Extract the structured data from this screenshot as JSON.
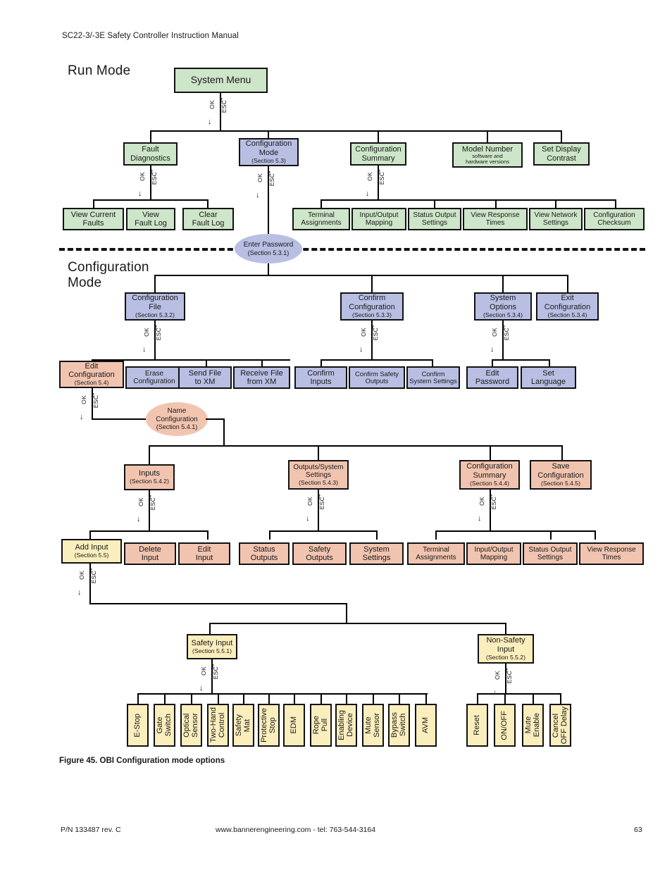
{
  "header": {
    "title": "SC22-3/-3E Safety Controller Instruction Manual"
  },
  "sections": {
    "run_mode": "Run Mode",
    "configuration_mode": "Configuration\nMode"
  },
  "caption": "Figure 45. OBI Configuration mode options",
  "footer": {
    "left": "P/N 133487 rev. C",
    "center": "www.bannerengineering.com - tel: 763-544-3164",
    "right": "63"
  },
  "keys": {
    "ok": "OK",
    "esc": "ESC",
    "arrow_down": "↓",
    "arrow_up": "↑"
  },
  "colors": {
    "green": "#cde5c8",
    "blue": "#b9bfe3",
    "salmon": "#f1c4b0",
    "yellow": "#faeebd",
    "border": "#111111"
  },
  "run_mode_nodes": {
    "system_menu": {
      "label": "System Menu"
    },
    "fault_diagnostics": {
      "label": "Fault\nDiagnostics"
    },
    "configuration_mode": {
      "label": "Configuration\nMode",
      "section": "(Section 5.3)"
    },
    "configuration_summary": {
      "label": "Configuration\nSummary"
    },
    "model_number": {
      "label": "Model Number",
      "sub": "software and\nhardware versions"
    },
    "set_display_contrast": {
      "label": "Set Display\nContrast"
    },
    "fault_children": [
      {
        "label": "View Current\nFaults"
      },
      {
        "label": "View\nFault Log"
      },
      {
        "label": "Clear\nFault Log"
      }
    ],
    "summary_children": [
      {
        "label": "Terminal\nAssignments"
      },
      {
        "label": "Input/Output\nMapping"
      },
      {
        "label": "Status Output\nSettings"
      },
      {
        "label": "View Response\nTimes"
      },
      {
        "label": "View Network\nSettings"
      },
      {
        "label": "Configuration\nChecksum"
      }
    ]
  },
  "enter_password": {
    "label": "Enter Password",
    "section": "(Section 5.3.1)"
  },
  "config_mode_nodes": {
    "configuration_file": {
      "label": "Configuration\nFile",
      "section": "(Section 5.3.2)"
    },
    "confirm_configuration": {
      "label": "Confirm\nConfiguration",
      "section": "(Section 5.3.3)"
    },
    "system_options": {
      "label": "System\nOptions",
      "section": "(Section 5.3.4)"
    },
    "exit_configuration": {
      "label": "Exit\nConfiguration",
      "section": "(Section 5.3.4)"
    },
    "file_children": [
      {
        "label": "Edit\nConfiguration",
        "section": "(Section 5.4)",
        "color": "salmon"
      },
      {
        "label": "Erase\nConfiguration",
        "color": "blue"
      },
      {
        "label": "Send File\nto XM",
        "color": "blue"
      },
      {
        "label": "Receive File\nfrom XM",
        "color": "blue"
      }
    ],
    "confirm_children": [
      {
        "label": "Confirm\nInputs"
      },
      {
        "label": "Confirm Safety\nOutputs"
      },
      {
        "label": "Confirm\nSystem Settings"
      }
    ],
    "options_children": [
      {
        "label": "Edit\nPassword"
      },
      {
        "label": "Set\nLanguage"
      }
    ]
  },
  "name_configuration": {
    "label": "Name\nConfiguration",
    "section": "(Section 5.4.1)"
  },
  "edit_config_nodes": {
    "inputs": {
      "label": "Inputs",
      "section": "(Section 5.4.2)"
    },
    "outputs_system_settings": {
      "label": "Outputs/System\nSettings",
      "section": "(Section 5.4.3)"
    },
    "configuration_summary": {
      "label": "Configuration\nSummary",
      "section": "(Section 5.4.4)"
    },
    "save_configuration": {
      "label": "Save\nConfiguration",
      "section": "(Section 5.4.5)"
    },
    "inputs_children": [
      {
        "label": "Add Input",
        "section": "(Section 5.5)",
        "color": "yellow"
      },
      {
        "label": "Delete\nInput",
        "color": "salmon"
      },
      {
        "label": "Edit\nInput",
        "color": "salmon"
      }
    ],
    "outputs_children": [
      {
        "label": "Status\nOutputs"
      },
      {
        "label": "Safety\nOutputs"
      },
      {
        "label": "System\nSettings"
      }
    ],
    "summary_children": [
      {
        "label": "Terminal\nAssignments"
      },
      {
        "label": "Input/Output\nMapping"
      },
      {
        "label": "Status Output\nSettings"
      },
      {
        "label": "View Response\nTimes"
      }
    ]
  },
  "add_input_nodes": {
    "safety_input": {
      "label": "Safety Input",
      "section": "(Section 5.5.1)"
    },
    "non_safety_input": {
      "label": "Non-Safety\nInput",
      "section": "(Section 5.5.2)"
    },
    "safety_types": [
      {
        "label": "E-Stop"
      },
      {
        "label": "Gate\nSwitch"
      },
      {
        "label": "Optical\nSensor"
      },
      {
        "label": "Two-Hand\nControl"
      },
      {
        "label": "Safety\nMat"
      },
      {
        "label": "Protective\nStop"
      },
      {
        "label": "EDM"
      },
      {
        "label": "Rope\nPull"
      },
      {
        "label": "Enabling\nDevice"
      },
      {
        "label": "Mute\nSensor"
      },
      {
        "label": "Bypass\nSwitch"
      },
      {
        "label": "AVM"
      }
    ],
    "non_safety_types": [
      {
        "label": "Reset"
      },
      {
        "label": "ON/OFF"
      },
      {
        "label": "Mute\nEnable"
      },
      {
        "label": "Cancel\nOFF Delay"
      }
    ]
  }
}
